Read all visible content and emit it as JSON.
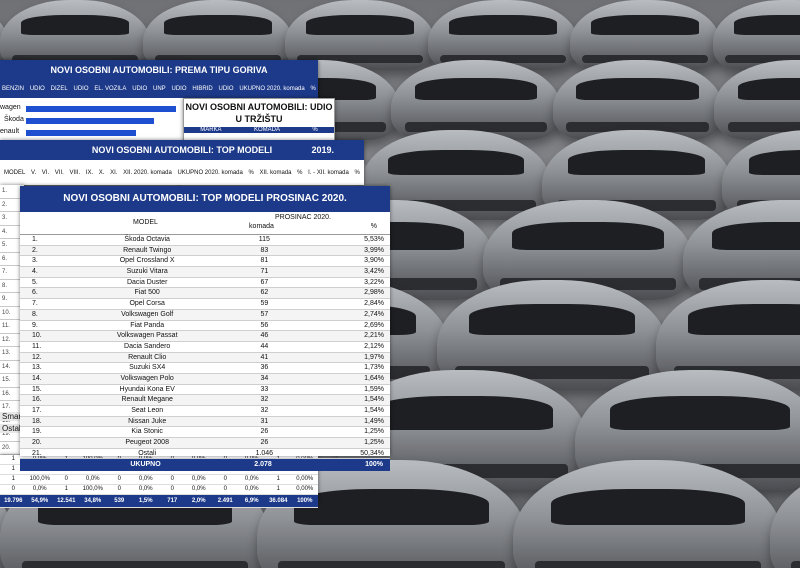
{
  "fuel_table": {
    "title": "NOVI OSOBNI AUTOMOBILI: PREMA TIPU GORIVA",
    "columns": [
      "BENZIN",
      "UDIO",
      "DIZEL",
      "UDIO",
      "EL. VOZILA",
      "UDIO",
      "UNP",
      "UDIO",
      "HIBRID",
      "UDIO",
      "UKUPNO 2020. komada",
      "%"
    ],
    "brands": [
      "wagen",
      "Škoda",
      "enault"
    ]
  },
  "share_table": {
    "title": "NOVI OSOBNI AUTOMOBILI: UDIO U TRŽIŠTU",
    "columns": [
      "MARKA",
      "KOMADA",
      "%"
    ]
  },
  "top_models_table": {
    "title": "NOVI OSOBNI AUTOMOBILI: TOP MODELI",
    "year": "2019.",
    "columns": [
      "MODEL",
      "V.",
      "VI.",
      "VII.",
      "VIII.",
      "IX.",
      "X.",
      "XI.",
      "XII. 2020. komada",
      "UKUPNO 2020. komada",
      "%",
      "XII. komada",
      "%",
      "I. - XII. komada",
      "%"
    ]
  },
  "side_labels": [
    "Smart",
    "Ostali"
  ],
  "bottom_rows": [
    [
      "1",
      "0,0%",
      "1",
      "100,0%",
      "0",
      "0,0%",
      "0",
      "0,0%",
      "0",
      "0,0%",
      "1",
      "0,00%"
    ],
    [
      "1",
      "100,0%",
      "0",
      "0,0%",
      "0",
      "0,0%",
      "0",
      "0,0%",
      "0",
      "0,0%",
      "1",
      "0,00%"
    ],
    [
      "1",
      "100,0%",
      "0",
      "0,0%",
      "0",
      "0,0%",
      "0",
      "0,0%",
      "0",
      "0,0%",
      "1",
      "0,00%"
    ],
    [
      "0",
      "0,0%",
      "1",
      "100,0%",
      "0",
      "0,0%",
      "0",
      "0,0%",
      "0",
      "0,0%",
      "1",
      "0,00%"
    ]
  ],
  "bottom_total": [
    "19.796",
    "54,9%",
    "12.541",
    "34,8%",
    "539",
    "1,5%",
    "717",
    "2,0%",
    "2.491",
    "6,9%",
    "36.084",
    "100%"
  ],
  "main_table": {
    "title": "NOVI OSOBNI AUTOMOBILI: TOP MODELI PROSINAC 2020.",
    "col_model": "MODEL",
    "col_period": "PROSINAC 2020.",
    "col_units": "komada",
    "col_pct": "%",
    "rows": [
      {
        "rank": "1.",
        "model": "Škoda Octavia",
        "units": "115",
        "pct": "5,53%"
      },
      {
        "rank": "2.",
        "model": "Renault Twingo",
        "units": "83",
        "pct": "3,99%"
      },
      {
        "rank": "3.",
        "model": "Opel Crossland X",
        "units": "81",
        "pct": "3,90%"
      },
      {
        "rank": "4.",
        "model": "Suzuki Vitara",
        "units": "71",
        "pct": "3,42%"
      },
      {
        "rank": "5.",
        "model": "Dacia Duster",
        "units": "67",
        "pct": "3,22%"
      },
      {
        "rank": "6.",
        "model": "Fiat 500",
        "units": "62",
        "pct": "2,98%"
      },
      {
        "rank": "7.",
        "model": "Opel Corsa",
        "units": "59",
        "pct": "2,84%"
      },
      {
        "rank": "8.",
        "model": "Volkswagen Golf",
        "units": "57",
        "pct": "2,74%"
      },
      {
        "rank": "9.",
        "model": "Fiat Panda",
        "units": "56",
        "pct": "2,69%"
      },
      {
        "rank": "10.",
        "model": "Volkswagen Passat",
        "units": "46",
        "pct": "2,21%"
      },
      {
        "rank": "11.",
        "model": "Dacia Sandero",
        "units": "44",
        "pct": "2,12%"
      },
      {
        "rank": "12.",
        "model": "Renault Clio",
        "units": "41",
        "pct": "1,97%"
      },
      {
        "rank": "13.",
        "model": "Suzuki SX4",
        "units": "36",
        "pct": "1,73%"
      },
      {
        "rank": "14.",
        "model": "Volkswagen Polo",
        "units": "34",
        "pct": "1,64%"
      },
      {
        "rank": "15.",
        "model": "Hyundai Kona EV",
        "units": "33",
        "pct": "1,59%"
      },
      {
        "rank": "16.",
        "model": "Renault Megane",
        "units": "32",
        "pct": "1,54%"
      },
      {
        "rank": "17.",
        "model": "Seat Leon",
        "units": "32",
        "pct": "1,54%"
      },
      {
        "rank": "18.",
        "model": "Nissan Juke",
        "units": "31",
        "pct": "1,49%"
      },
      {
        "rank": "19.",
        "model": "Kia Stonic",
        "units": "26",
        "pct": "1,25%"
      },
      {
        "rank": "20.",
        "model": "Peugeot 2008",
        "units": "26",
        "pct": "1,25%"
      },
      {
        "rank": "21.",
        "model": "Ostali",
        "units": "1.046",
        "pct": "50,34%"
      }
    ],
    "total_label": "UKUPNO",
    "total_units": "2.078",
    "total_pct": "100%"
  },
  "strip_labels": [
    "1.",
    "2.",
    "3.",
    "4.",
    "5.",
    "6.",
    "7.",
    "8.",
    "9.",
    "10.",
    "11.",
    "12.",
    "13.",
    "14.",
    "15.",
    "16.",
    "17.",
    "18.",
    "19.",
    "20.",
    "21."
  ]
}
